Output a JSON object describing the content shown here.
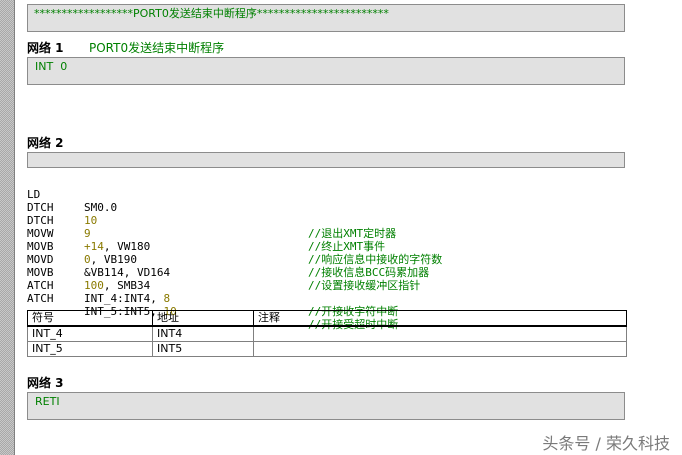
{
  "header": {
    "title": "******************PORT0发送结束中断程序************************"
  },
  "networks": [
    {
      "label": "网络 1",
      "comment": "PORT0发送结束中断程序",
      "code": [
        {
          "op": "INT",
          "arg": "0",
          "comment": ""
        }
      ]
    },
    {
      "label": "网络 2",
      "code": [
        {
          "op": "LD",
          "arg": "SM0.0",
          "arg_hl": "",
          "arg_tail": "",
          "comment": ""
        },
        {
          "op": "DTCH",
          "arg": "",
          "arg_hl": "10",
          "arg_tail": "",
          "comment": "//退出XMT定时器"
        },
        {
          "op": "DTCH",
          "arg": "",
          "arg_hl": "9",
          "arg_tail": "",
          "comment": "//终止XMT事件"
        },
        {
          "op": "MOVW",
          "arg": "",
          "arg_hl": "+14",
          "arg_tail": ", VW180",
          "comment": "//响应信息中接收的字符数"
        },
        {
          "op": "MOVB",
          "arg": "",
          "arg_hl": "0",
          "arg_tail": ", VB190",
          "comment": "//接收信息BCC码累加器"
        },
        {
          "op": "MOVD",
          "arg": "&VB114, VD164",
          "arg_hl": "",
          "arg_tail": "",
          "comment": "//设置接收缓冲区指针"
        },
        {
          "op": "MOVB",
          "arg": "",
          "arg_hl": "100",
          "arg_tail": ", SMB34",
          "comment": ""
        },
        {
          "op": "ATCH",
          "arg": "INT_4:INT4, ",
          "arg_hl": "8",
          "arg_tail": "",
          "comment": "//开接收字符中断"
        },
        {
          "op": "ATCH",
          "arg": "INT_5:INT5, ",
          "arg_hl": "10",
          "arg_tail": "",
          "comment": "//开接受超时中断"
        }
      ],
      "symbol_table": {
        "headers": [
          "符号",
          "地址",
          "注释"
        ],
        "rows": [
          [
            "INT_4",
            "INT4",
            ""
          ],
          [
            "INT_5",
            "INT5",
            ""
          ]
        ]
      }
    },
    {
      "label": "网络 3",
      "code": [
        {
          "op": "RETI",
          "arg": "",
          "comment": ""
        }
      ]
    }
  ],
  "watermark": "头条号 / 荣久科技",
  "colors": {
    "comment": "#008000",
    "literal": "#8a7a00",
    "box_bg": "#e1e1e1"
  }
}
